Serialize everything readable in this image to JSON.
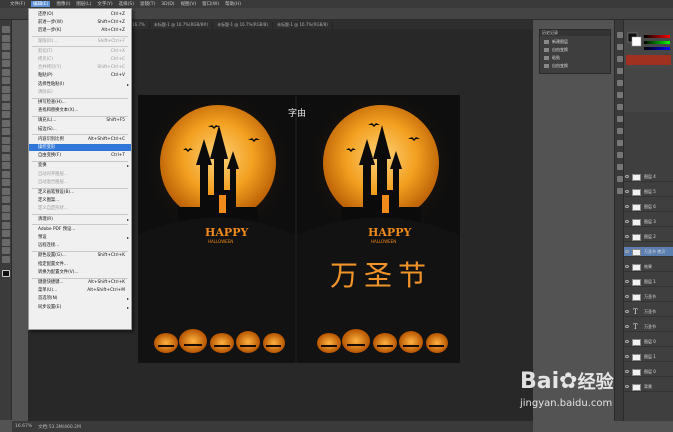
{
  "menubar": {
    "items": [
      "文件(F)",
      "编辑(E)",
      "图像(I)",
      "图层(L)",
      "文字(Y)",
      "选择(S)",
      "滤镜(T)",
      "3D(D)",
      "视图(V)",
      "窗口(W)",
      "帮助(H)"
    ]
  },
  "tabs": [
    "未标题-1 @ 16.7%(图层 1, RGB/8#)",
    "未标题-1 @ 16.7%",
    "未标题-1 @ 16.7%(RGB/8#)",
    "未标题-1 @ 16.7%(RGB/8)",
    "未标题-1 @ 16.7%(RGB/8)"
  ],
  "edit_menu": {
    "items": [
      {
        "label": "还原(O)",
        "shortcut": "Ctrl+Z",
        "disabled": false
      },
      {
        "label": "前进一步(W)",
        "shortcut": "Shift+Ctrl+Z",
        "disabled": false
      },
      {
        "label": "后退一步(K)",
        "shortcut": "Alt+Ctrl+Z",
        "disabled": false
      },
      {
        "label": "渐隐(D)...",
        "shortcut": "Shift+Ctrl+F",
        "disabled": true
      },
      {
        "label": "剪切(T)",
        "shortcut": "Ctrl+X",
        "disabled": true
      },
      {
        "label": "拷贝(C)",
        "shortcut": "Ctrl+C",
        "disabled": true
      },
      {
        "label": "合并拷贝(Y)",
        "shortcut": "Shift+Ctrl+C",
        "disabled": true
      },
      {
        "label": "粘贴(P)",
        "shortcut": "Ctrl+V",
        "disabled": false
      },
      {
        "label": "选择性粘贴(I)",
        "shortcut": "",
        "disabled": false,
        "submenu": true
      },
      {
        "label": "清除(E)",
        "shortcut": "",
        "disabled": true
      },
      {
        "label": "拼写检查(H)...",
        "shortcut": "",
        "disabled": false
      },
      {
        "label": "查找和替换文本(X)...",
        "shortcut": "",
        "disabled": false
      },
      {
        "label": "填充(L)...",
        "shortcut": "Shift+F5",
        "disabled": false
      },
      {
        "label": "描边(S)...",
        "shortcut": "",
        "disabled": false
      },
      {
        "label": "内容识别比例",
        "shortcut": "Alt+Shift+Ctrl+C",
        "disabled": false
      },
      {
        "label": "操控变形",
        "shortcut": "",
        "disabled": false,
        "highlighted": true
      },
      {
        "label": "自由变换(F)",
        "shortcut": "Ctrl+T",
        "disabled": false
      },
      {
        "label": "变换",
        "shortcut": "",
        "disabled": false,
        "submenu": true
      },
      {
        "label": "自动对齐图层...",
        "shortcut": "",
        "disabled": true
      },
      {
        "label": "自动混合图层...",
        "shortcut": "",
        "disabled": true
      },
      {
        "label": "定义画笔预设(B)...",
        "shortcut": "",
        "disabled": false
      },
      {
        "label": "定义图案...",
        "shortcut": "",
        "disabled": false
      },
      {
        "label": "定义自定形状...",
        "shortcut": "",
        "disabled": true
      },
      {
        "label": "清理(R)",
        "shortcut": "",
        "disabled": false,
        "submenu": true
      },
      {
        "label": "Adobe PDF 预设...",
        "shortcut": "",
        "disabled": false
      },
      {
        "label": "预设",
        "shortcut": "",
        "disabled": false,
        "submenu": true
      },
      {
        "label": "远程连接...",
        "shortcut": "",
        "disabled": false
      },
      {
        "label": "颜色设置(G)...",
        "shortcut": "Shift+Ctrl+K",
        "disabled": false
      },
      {
        "label": "指定配置文件...",
        "shortcut": "",
        "disabled": false
      },
      {
        "label": "转换为配置文件(V)...",
        "shortcut": "",
        "disabled": false
      },
      {
        "label": "键盘快捷键...",
        "shortcut": "Alt+Shift+Ctrl+K",
        "disabled": false
      },
      {
        "label": "菜单(U)...",
        "shortcut": "Alt+Shift+Ctrl+M",
        "disabled": false
      },
      {
        "label": "首选项(N)",
        "shortcut": "",
        "disabled": false,
        "submenu": true
      },
      {
        "label": "同步设置(E)",
        "shortcut": "",
        "disabled": false,
        "submenu": true
      }
    ]
  },
  "history": {
    "tab": "历史记录",
    "items": [
      "新建图层",
      "自由变换",
      "粘贴",
      "自由变换"
    ]
  },
  "canvas": {
    "caption": "字由",
    "happy": "HAPPY",
    "halloween": "HALLOWEEN",
    "title": "万圣节",
    "bg_color": "#0e0e0e",
    "moon_color": "#f5a623"
  },
  "layers": {
    "items": [
      {
        "name": "图层 4",
        "type": "raster"
      },
      {
        "name": "图层 5",
        "type": "raster"
      },
      {
        "name": "图层 6",
        "type": "raster"
      },
      {
        "name": "图层 3",
        "type": "raster"
      },
      {
        "name": "图层 2",
        "type": "raster"
      },
      {
        "name": "万圣节 拷贝",
        "type": "raster",
        "selected": true
      },
      {
        "name": "效果",
        "type": "raster"
      },
      {
        "name": "图层 1",
        "type": "raster"
      },
      {
        "name": "万圣节",
        "type": "raster"
      },
      {
        "name": "万圣节",
        "type": "text"
      },
      {
        "name": "万圣节",
        "type": "text"
      },
      {
        "name": "图层 0",
        "type": "raster"
      },
      {
        "name": "图层 1",
        "type": "raster"
      },
      {
        "name": "图层 0",
        "type": "raster"
      },
      {
        "name": "背景",
        "type": "raster"
      }
    ]
  },
  "status": {
    "zoom": "16.67%",
    "doc": "文档:53.3M/460.2M"
  },
  "watermark": {
    "brand": "Bai",
    "brand_suffix": "经验",
    "url": "jingyan.baidu.com"
  }
}
